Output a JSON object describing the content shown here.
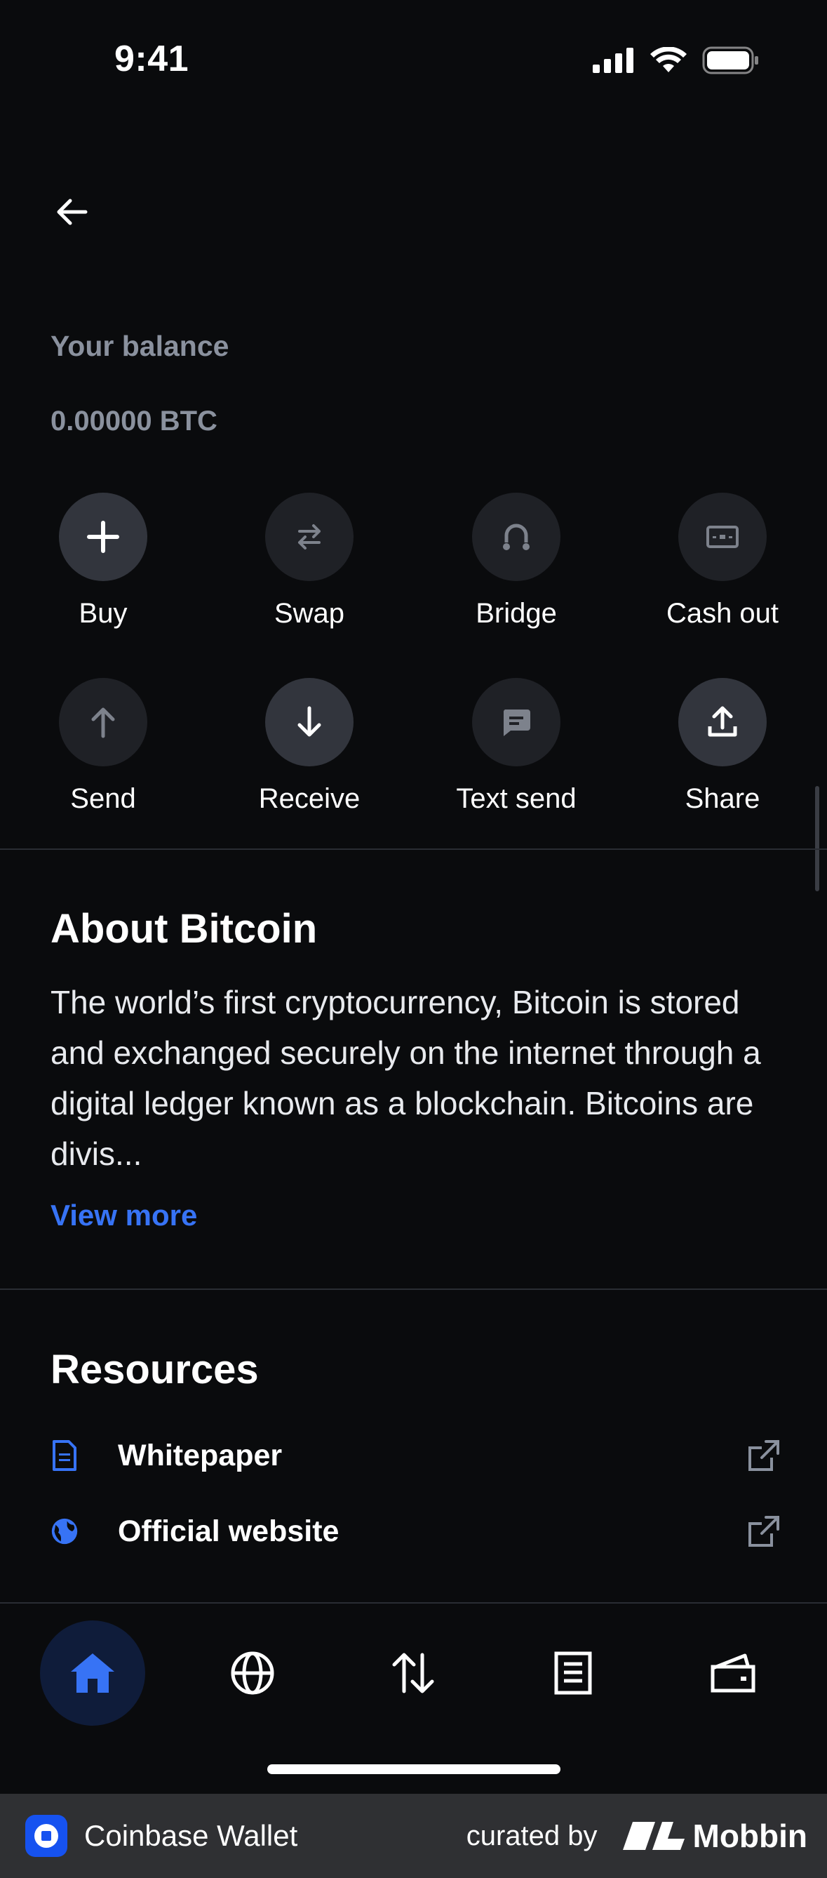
{
  "status_bar": {
    "time": "9:41"
  },
  "balance": {
    "label": "Your balance",
    "value": "0.00000 BTC"
  },
  "actions": [
    {
      "label": "Buy",
      "icon": "plus-icon"
    },
    {
      "label": "Swap",
      "icon": "swap-icon"
    },
    {
      "label": "Bridge",
      "icon": "bridge-icon"
    },
    {
      "label": "Cash out",
      "icon": "cash-out-icon"
    },
    {
      "label": "Send",
      "icon": "arrow-up-icon"
    },
    {
      "label": "Receive",
      "icon": "arrow-down-icon"
    },
    {
      "label": "Text send",
      "icon": "message-icon"
    },
    {
      "label": "Share",
      "icon": "share-icon"
    }
  ],
  "about": {
    "title": "About Bitcoin",
    "text": "The world’s first cryptocurrency, Bitcoin is stored and exchanged securely on the internet through a digital ledger known as a blockchain. Bitcoins are divis...",
    "view_more": "View more"
  },
  "resources": {
    "title": "Resources",
    "items": [
      {
        "label": "Whitepaper",
        "icon": "document-icon"
      },
      {
        "label": "Official website",
        "icon": "globe-icon"
      }
    ]
  },
  "tabs": [
    {
      "name": "home",
      "active": true
    },
    {
      "name": "browser",
      "active": false
    },
    {
      "name": "trade",
      "active": false
    },
    {
      "name": "activity",
      "active": false
    },
    {
      "name": "wallet",
      "active": false
    }
  ],
  "footer": {
    "app_name": "Coinbase Wallet",
    "curated_by": "curated by",
    "brand": "Mobbin"
  },
  "colors": {
    "background": "#0a0b0d",
    "accent": "#3773f5",
    "muted": "#8a919e"
  }
}
